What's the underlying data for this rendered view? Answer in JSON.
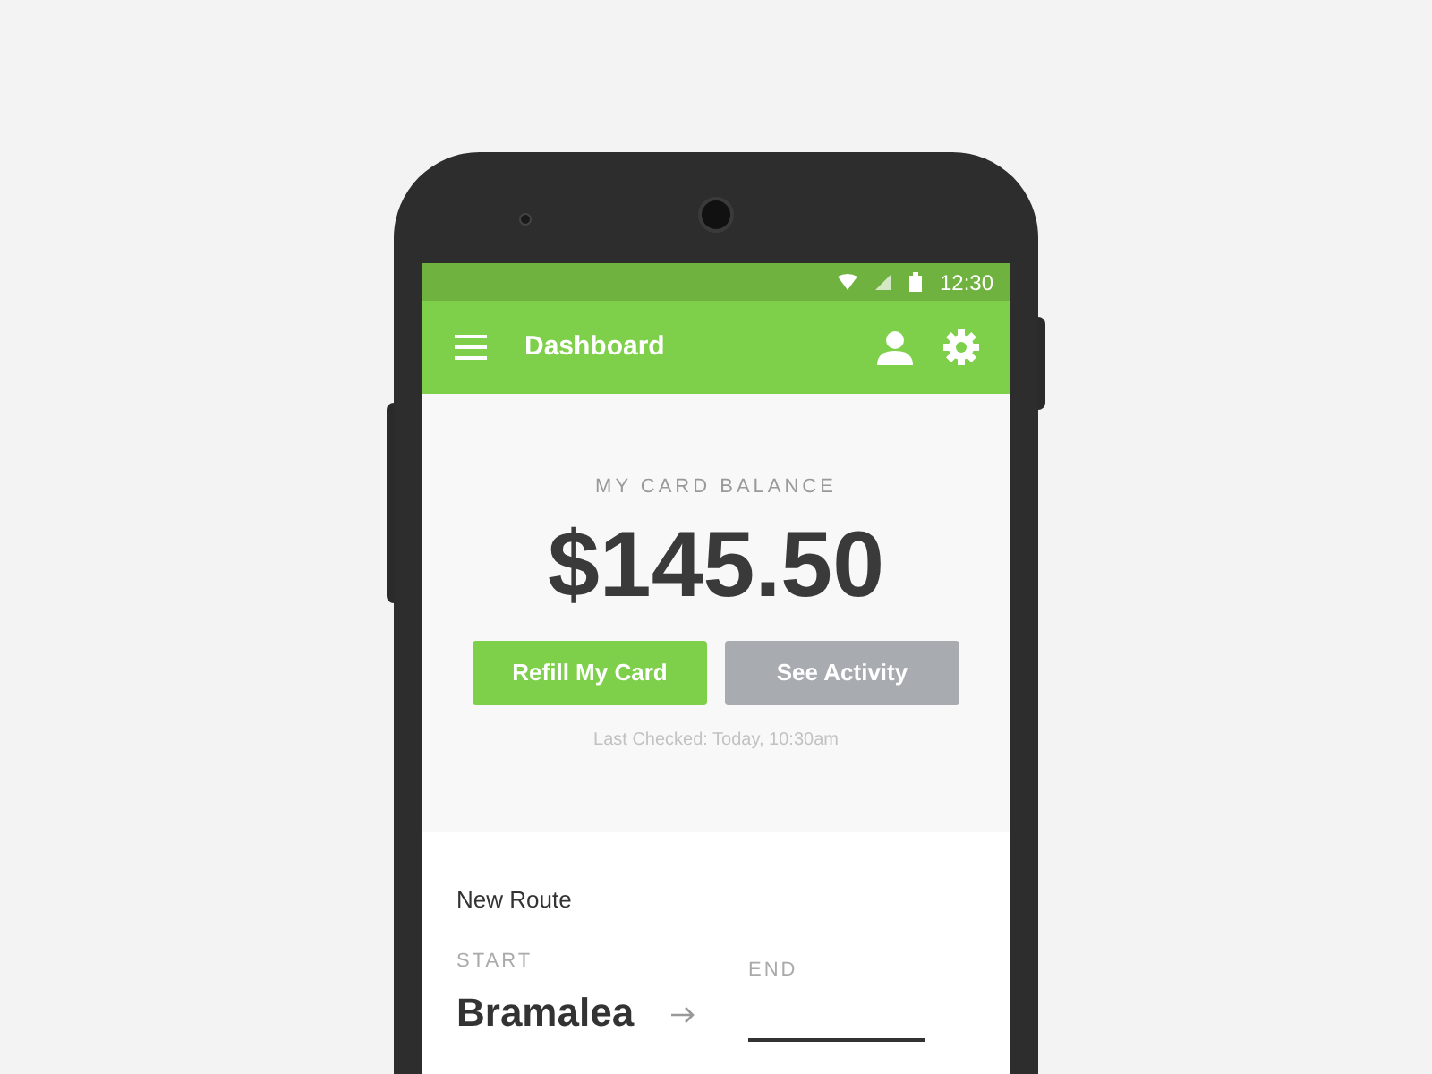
{
  "status_bar": {
    "time": "12:30"
  },
  "app_bar": {
    "title": "Dashboard"
  },
  "balance": {
    "label": "MY CARD BALANCE",
    "amount": "$145.50",
    "buttons": [
      {
        "label": "Refill My Card",
        "kind": "primary"
      },
      {
        "label": "See Activity",
        "kind": "secondary"
      }
    ],
    "last_checked": "Last Checked: Today, 10:30am"
  },
  "route": {
    "title": "New Route",
    "start": {
      "label": "START",
      "value": "Bramalea"
    },
    "end": {
      "label": "END"
    }
  }
}
